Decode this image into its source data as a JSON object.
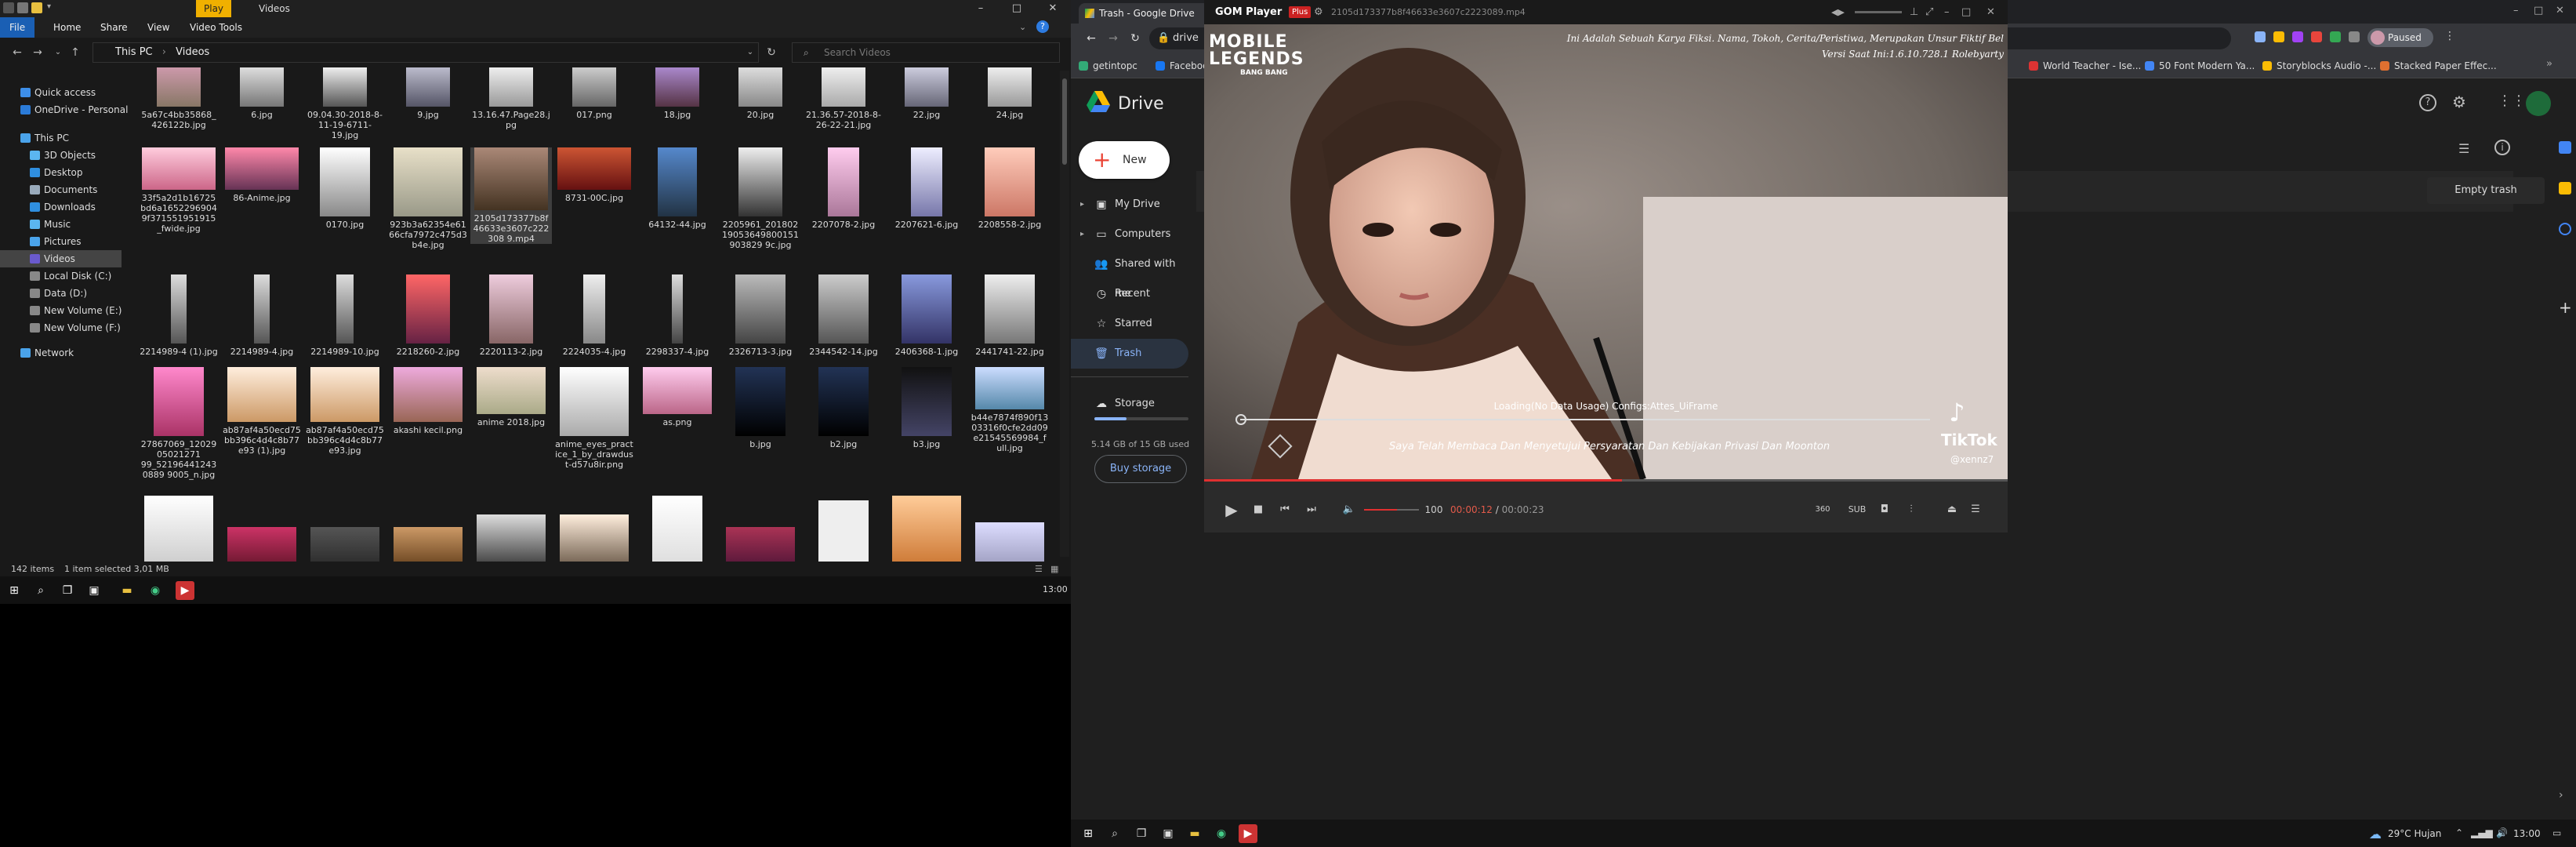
{
  "explorer": {
    "title_tabs": {
      "play": "Play",
      "videos": "Videos"
    },
    "ribbon": [
      "File",
      "Home",
      "Share",
      "View",
      "Video Tools"
    ],
    "address": {
      "root": "This PC",
      "folder": "Videos"
    },
    "search_placeholder": "Search Videos",
    "sidebar": [
      "Quick access",
      "OneDrive - Personal",
      "This PC",
      "3D Objects",
      "Desktop",
      "Documents",
      "Downloads",
      "Music",
      "Pictures",
      "Videos",
      "Local Disk (C:)",
      "Data (D:)",
      "New Volume (E:)",
      "New Volume (F:)",
      "Network"
    ],
    "row0": [
      "5a67c4bb35868_426122b.jpg",
      "6.jpg",
      "09.04.30-2018-8-11-19-6711-19.jpg",
      "9.jpg",
      "13.16.47.Page28.jpg",
      "017.png",
      "18.jpg",
      "20.jpg",
      "21.36.57-2018-8-26-22-21.jpg",
      "22.jpg",
      "24.jpg"
    ],
    "row1": [
      "33f5a2d1b16725bd6a16522969049f371551951915_fwide.jpg",
      "86-Anime.jpg",
      "0170.jpg",
      "923b3a62354e6166cfa7972c475d3b4e.jpg",
      "2105d173377b8f46633e3607c222308 9.mp4",
      "8731-00C.jpg",
      "64132-44.jpg",
      "2205961_20180219053649800151903829 9c.jpg",
      "2207078-2.jpg",
      "2207621-6.jpg",
      "2208558-2.jpg"
    ],
    "row2": [
      "2214989-4 (1).jpg",
      "2214989-4.jpg",
      "2214989-10.jpg",
      "2218260-2.jpg",
      "2220113-2.jpg",
      "2224035-4.jpg",
      "2298337-4.jpg",
      "2326713-3.jpg",
      "2344542-14.jpg",
      "2406368-1.jpg",
      "2441741-22.jpg"
    ],
    "row3": [
      "27867069_1202905021271 99_521964412430889 9005_n.jpg",
      "ab87af4a50ecd75bb396c4d4c8b77e93 (1).jpg",
      "ab87af4a50ecd75bb396c4d4c8b77e93.jpg",
      "akashi kecil.png",
      "anime 2018.jpg",
      "anime_eyes_practice_1_by_drawdust-d57u8ir.png",
      "as.png",
      "b.jpg",
      "b2.jpg",
      "b3.jpg",
      "b44e7874f890f1303316f0cfe2dd09e21545569984_full.jpg"
    ],
    "status": {
      "items": "142 items",
      "selected": "1 item selected  3,01 MB"
    },
    "clock": "13:00"
  },
  "chrome": {
    "tab_title": "Trash - Google Drive",
    "omnibox": "drive",
    "paused": "Paused",
    "bookmarks_left": [
      "getintopc",
      "Facebook"
    ],
    "bookmarks_right": [
      "World Teacher - Ise...",
      "50 Font Modern Ya...",
      "Storyblocks Audio -...",
      "Stacked Paper Effec..."
    ]
  },
  "drive": {
    "name": "Drive",
    "new_label": "New",
    "nav": [
      "My Drive",
      "Computers",
      "Shared with me",
      "Recent",
      "Starred",
      "Trash",
      "Storage"
    ],
    "storage_text": "5.14 GB of 15 GB used",
    "storage_fraction": 0.34,
    "buy": "Buy storage",
    "empty_trash": "Empty trash"
  },
  "gom": {
    "app": "GOM Player",
    "plus": "Plus",
    "file": "2105d173377b8f46633e3607c2223089.mp4",
    "overlay_top1": "Ini Adalah Sebuah Karya Fiksi. Nama, Tokoh, Cerita/Peristiwa, Merupakan Unsur Fiktif Bel",
    "overlay_top2": "Versi Saat Ini:1.6.10.728.1 Rolebyarty",
    "logo_line1": "MOBILE",
    "logo_line2": "LEGENDS",
    "logo_line3": "BANG BANG",
    "loading": "Loading(No Data Usage) Configs:Attes_UiFrame",
    "consent": "Saya Telah Membaca Dan Menyetujui Persyaratan Dan Kebijakan Privasi Dan Moonton",
    "tiktok": "TikTok",
    "tiktok_user": "@xennz7",
    "volume": "100",
    "time_cur": "00:00:12",
    "time_sep": "/",
    "time_total": "00:00:23",
    "sub": "SUB",
    "progress": 0.52
  },
  "taskbar_right": {
    "weather": "29°C  Hujan",
    "clock": "13:00"
  }
}
